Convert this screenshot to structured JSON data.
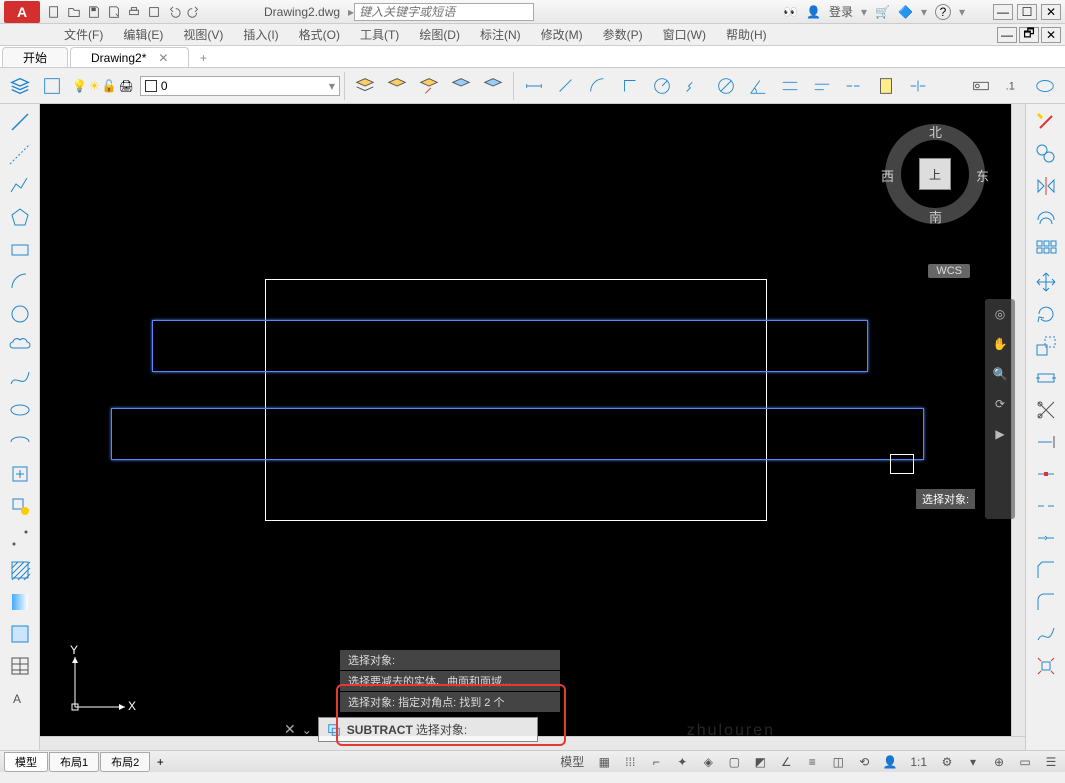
{
  "title": "Drawing2.dwg",
  "search_placeholder": "键入关键字或短语",
  "login_text": "登录",
  "menus": [
    "文件(F)",
    "编辑(E)",
    "视图(V)",
    "插入(I)",
    "格式(O)",
    "工具(T)",
    "绘图(D)",
    "标注(N)",
    "修改(M)",
    "参数(P)",
    "窗口(W)",
    "帮助(H)"
  ],
  "tabs": {
    "start": "开始",
    "doc": "Drawing2*"
  },
  "layer": {
    "name": "0"
  },
  "viewcube": {
    "top": "上",
    "n": "北",
    "s": "南",
    "e": "东",
    "w": "西"
  },
  "wcs": "WCS",
  "tooltip": "选择对象:",
  "cmd_history": [
    "选择对象:",
    "选择要减去的实体、曲面和面域...",
    "选择对象: 指定对角点: 找到 2 个"
  ],
  "cmd_prompt": {
    "cmd": "SUBTRACT",
    "rest": "选择对象:"
  },
  "layout_tabs": [
    "模型",
    "布局1",
    "布局2"
  ],
  "status_model": "模型",
  "scale": "1:1",
  "ucs": {
    "x": "X",
    "y": "Y"
  },
  "watermark": "zhulouren"
}
